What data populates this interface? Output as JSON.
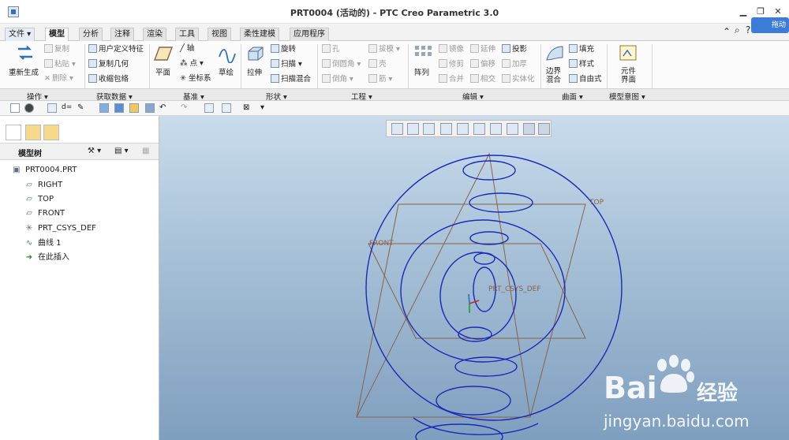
{
  "window": {
    "title": "PRT0004 (活动的) - PTC Creo Parametric 3.0",
    "min_glyph": "▁",
    "restore_glyph": "❐",
    "close_glyph": "✕"
  },
  "tabs": [
    {
      "label": "文件 ▾"
    },
    {
      "label": "模型"
    },
    {
      "label": "分析"
    },
    {
      "label": "注释"
    },
    {
      "label": "渲染"
    },
    {
      "label": "工具"
    },
    {
      "label": "视图"
    },
    {
      "label": "柔性建模"
    },
    {
      "label": "应用程序"
    }
  ],
  "tab_right": {
    "help_icon": "⌃",
    "search_icon": "⌕",
    "help2_icon": "?",
    "badge_text": "拖动"
  },
  "ribbon": {
    "regen": "重新生成",
    "copy": "复制",
    "paste": "粘贴 ▾",
    "delete": "删除 ▾",
    "user_feature": "用户定义特征",
    "copy_geom": "复制几何",
    "shrinkwrap": "收缩包络",
    "plane": "平面",
    "axis": "轴",
    "point": "点 ▾",
    "csys": "坐标系",
    "sketch": "草绘",
    "extrude": "拉伸",
    "revolve": "旋转",
    "sweep": "扫描 ▾",
    "swept_blend": "扫描混合",
    "hole": "孔",
    "round": "倒圆角 ▾",
    "chamfer": "倒角 ▾",
    "draft": "拔模 ▾",
    "shell": "壳",
    "rib": "筋 ▾",
    "pattern": "阵列",
    "mirror": "镜像",
    "extend": "延伸",
    "project": "投影",
    "trim": "修剪",
    "offset": "偏移",
    "thicken": "加厚",
    "merge": "合并",
    "intersect": "相交",
    "solidify": "实体化",
    "boundary_blend": "边界 混合",
    "fill": "填充",
    "style": "样式",
    "freestyle": "自由式",
    "component_interface": "元件 界面"
  },
  "groups": [
    "操作 ▾",
    "获取数据 ▾",
    "基准 ▾",
    "形状 ▾",
    "工程 ▾",
    "编辑 ▾",
    "曲面 ▾",
    "模型意图 ▾"
  ],
  "left_panel": {
    "title": "模型树",
    "tool_icon": "⚒ ▾",
    "view_icon": "▤ ▾",
    "items": [
      {
        "label": "PRT0004.PRT",
        "icon": "part-icon"
      },
      {
        "label": "RIGHT",
        "icon": "datum-plane-icon"
      },
      {
        "label": "TOP",
        "icon": "datum-plane-icon"
      },
      {
        "label": "FRONT",
        "icon": "datum-plane-icon"
      },
      {
        "label": "PRT_CSYS_DEF",
        "icon": "csys-icon"
      },
      {
        "label": "曲线 1",
        "icon": "curve-icon"
      },
      {
        "label": "在此插入",
        "icon": "insert-arrow-icon"
      }
    ]
  },
  "viewport": {
    "label_top": "TOP",
    "label_front": "FRONT",
    "label_csys": "PRT_CSYS_DEF"
  },
  "watermark": {
    "brand": "Bai",
    "brand2": "经验",
    "url": "jingyan.baidu.com"
  },
  "colors": {
    "curve": "#1a2ab8",
    "datum": "#8a6248",
    "accent": "#2f6fbf"
  }
}
